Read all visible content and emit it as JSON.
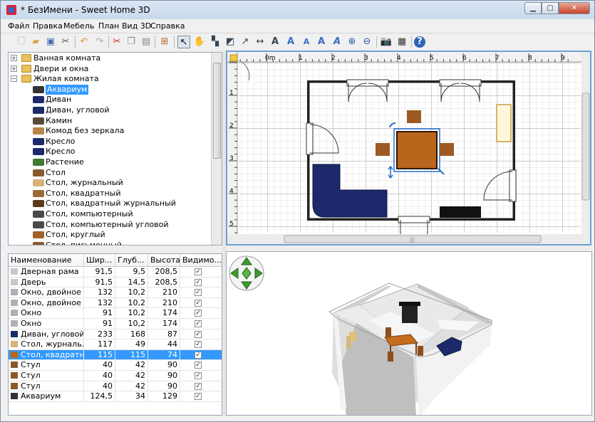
{
  "window": {
    "title": "* БезИмени - Sweet Home 3D",
    "min_glyph": "▁",
    "max_glyph": "▢",
    "close_glyph": "✕"
  },
  "menu": [
    "Файл",
    "Правка",
    "Мебель",
    "План",
    "Вид 3D",
    "Справка"
  ],
  "toolbar_icons": [
    "new-file-icon",
    "open-folder-icon",
    "save-icon",
    "cut-scissors-icon",
    "undo-icon",
    "redo-icon",
    "cut-icon",
    "copy-icon",
    "paste-icon",
    "add-furniture-icon",
    "select-arrow-icon",
    "pan-hand-icon",
    "create-walls-icon",
    "create-rooms-icon",
    "create-dimensions-icon",
    "add-text-icon",
    "font-increase-icon",
    "font-bold-icon",
    "font-italic-icon",
    "font-decrease-icon",
    "zoom-in-icon",
    "zoom-out-icon",
    "create-photo-icon",
    "create-video-icon",
    "help-icon"
  ],
  "catalog": {
    "categories": [
      {
        "label": "Ванная комната",
        "expanded": false
      },
      {
        "label": "Двери и окна",
        "expanded": false
      },
      {
        "label": "Жилая комната",
        "expanded": true
      }
    ],
    "items": [
      {
        "label": "Аквариум",
        "selected": true,
        "icon": "aquarium-icon"
      },
      {
        "label": "Диван",
        "icon": "sofa-icon"
      },
      {
        "label": "Диван, угловой",
        "icon": "corner-sofa-icon"
      },
      {
        "label": "Камин",
        "icon": "fireplace-icon"
      },
      {
        "label": "Комод без зеркала",
        "icon": "dresser-icon"
      },
      {
        "label": "Кресло",
        "icon": "armchair-icon"
      },
      {
        "label": "Кресло",
        "icon": "armchair-icon"
      },
      {
        "label": "Растение",
        "icon": "plant-icon"
      },
      {
        "label": "Стол",
        "icon": "table-icon"
      },
      {
        "label": "Стол, журнальный",
        "icon": "coffee-table-icon"
      },
      {
        "label": "Стол, квадратный",
        "icon": "square-table-icon"
      },
      {
        "label": "Стол, квадратный журнальный",
        "icon": "square-coffee-table-icon"
      },
      {
        "label": "Стол, компьютерный",
        "icon": "computer-desk-icon"
      },
      {
        "label": "Стол, компьютерный угловой",
        "icon": "corner-computer-desk-icon"
      },
      {
        "label": "Стол, круглый",
        "icon": "round-table-icon"
      },
      {
        "label": "Стол, письменный",
        "icon": "writing-desk-icon"
      }
    ]
  },
  "furniture_table": {
    "headers": [
      "Наименование",
      "Шир...",
      "Глуб...",
      "Высота",
      "Видимо..."
    ],
    "rows": [
      {
        "name": "Дверная рама",
        "w": "91,5",
        "d": "9,5",
        "h": "208,5",
        "visible": true,
        "icon": "door-frame-icon",
        "color": "#c8c8c8"
      },
      {
        "name": "Дверь",
        "w": "91,5",
        "d": "14,5",
        "h": "208,5",
        "visible": true,
        "icon": "door-icon",
        "color": "#c8c8c8"
      },
      {
        "name": "Окно, двойное ...",
        "w": "132",
        "d": "10,2",
        "h": "210",
        "visible": true,
        "icon": "double-window-icon",
        "color": "#b0b0b0"
      },
      {
        "name": "Окно, двойное ...",
        "w": "132",
        "d": "10,2",
        "h": "210",
        "visible": true,
        "icon": "double-window-icon",
        "color": "#b0b0b0"
      },
      {
        "name": "Окно",
        "w": "91",
        "d": "10,2",
        "h": "174",
        "visible": true,
        "icon": "window-icon",
        "color": "#b0b0b0"
      },
      {
        "name": "Окно",
        "w": "91",
        "d": "10,2",
        "h": "174",
        "visible": true,
        "icon": "window-icon",
        "color": "#b0b0b0"
      },
      {
        "name": "Диван, угловой",
        "w": "233",
        "d": "168",
        "h": "87",
        "visible": true,
        "icon": "corner-sofa-icon",
        "color": "#1c2a6b"
      },
      {
        "name": "Стол, журналь...",
        "w": "117",
        "d": "49",
        "h": "44",
        "visible": true,
        "icon": "coffee-table-icon",
        "color": "#d8b27a"
      },
      {
        "name": "Стол, квадратн...",
        "w": "115",
        "d": "115",
        "h": "74",
        "visible": true,
        "icon": "square-table-icon",
        "color": "#b9651c",
        "selected": true
      },
      {
        "name": "Стул",
        "w": "40",
        "d": "42",
        "h": "90",
        "visible": true,
        "icon": "chair-icon",
        "color": "#8b5a2b"
      },
      {
        "name": "Стул",
        "w": "40",
        "d": "42",
        "h": "90",
        "visible": true,
        "icon": "chair-icon",
        "color": "#8b5a2b"
      },
      {
        "name": "Стул",
        "w": "40",
        "d": "42",
        "h": "90",
        "visible": true,
        "icon": "chair-icon",
        "color": "#8b5a2b"
      },
      {
        "name": "Аквариум",
        "w": "124,5",
        "d": "34",
        "h": "129",
        "visible": true,
        "icon": "aquarium-icon",
        "color": "#333333"
      }
    ]
  },
  "plan": {
    "ruler_top": [
      "0m",
      "1",
      "2",
      "3",
      "4",
      "5",
      "6",
      "7",
      "8",
      "9"
    ],
    "ruler_left": [
      "1",
      "2",
      "3",
      "4",
      "5"
    ],
    "hscroll_glyph": "|||",
    "vscroll_glyph": "≡"
  },
  "colors": {
    "accent": "#3399ff",
    "sofa": "#1c2a6b",
    "table": "#b9651c",
    "chair": "#9c5a22",
    "nav_arrows": "#3f9c2f"
  }
}
